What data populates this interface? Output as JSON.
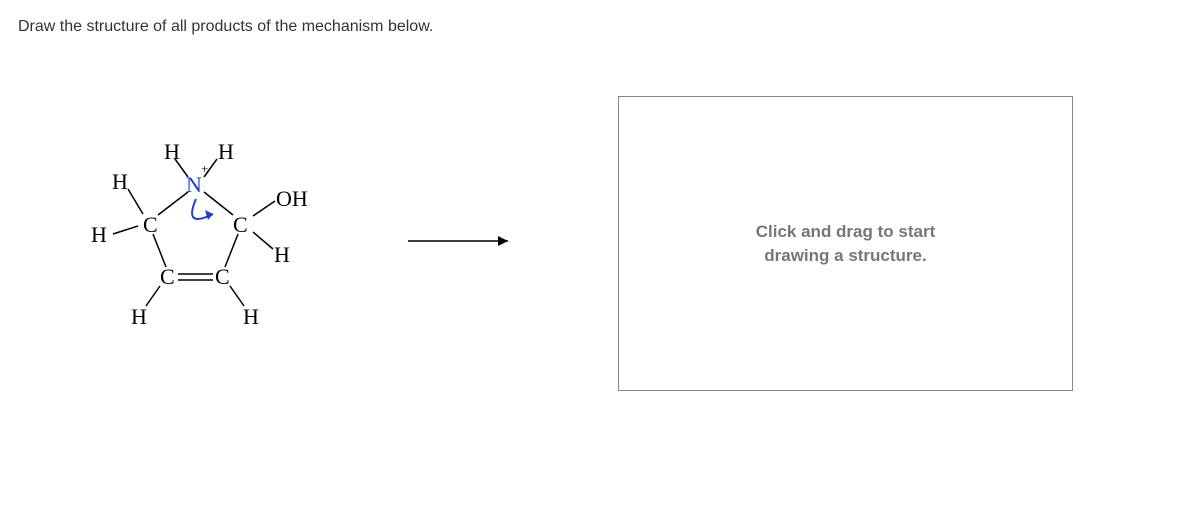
{
  "prompt": "Draw the structure of all products of the mechanism below.",
  "atoms": {
    "H_top_left": "H",
    "H_top_right": "H",
    "charge_plus": "+",
    "N": "N",
    "H_upper_left": "H",
    "C_left": "C",
    "C_right": "C",
    "OH": "OH",
    "H_left": "H",
    "H_right_inner": "H",
    "C_bottom_left": "C",
    "C_bottom_right": "C",
    "H_bottom_left": "H",
    "H_bottom_right": "H"
  },
  "canvas_placeholder_line1": "Click and drag to start",
  "canvas_placeholder_line2": "drawing a structure."
}
